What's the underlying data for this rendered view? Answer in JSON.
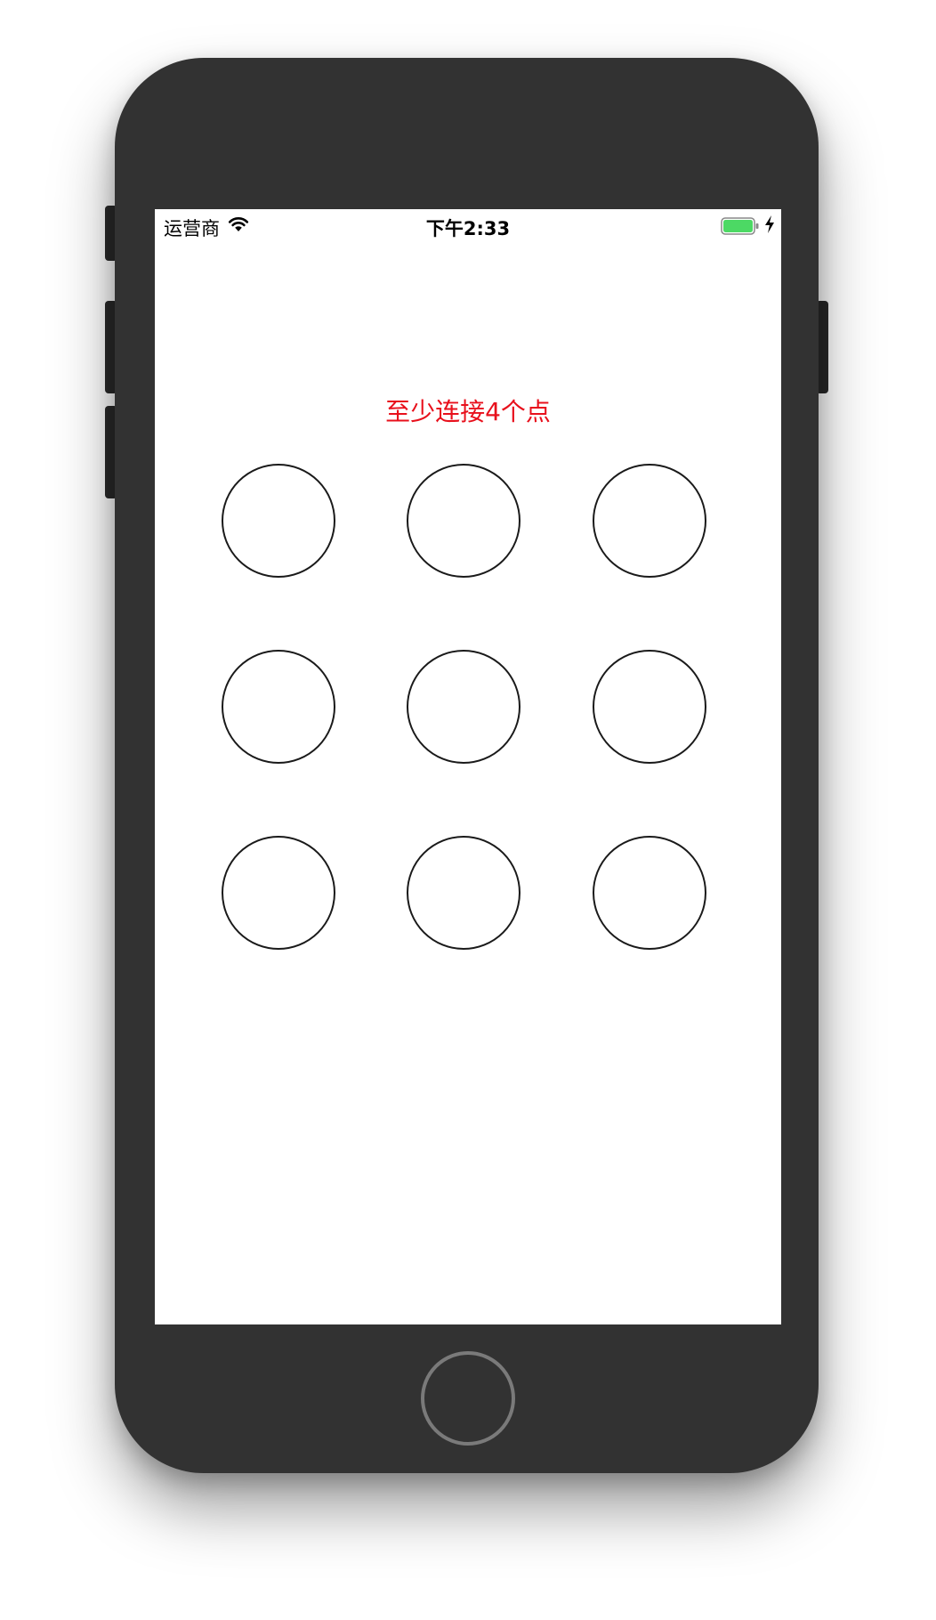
{
  "status_bar": {
    "carrier": "运营商",
    "time": "下午2:33",
    "wifi_icon": "wifi-icon",
    "battery_icon": "battery-full-icon",
    "battery_color": "#4cd964",
    "charging_icon": "charging-bolt-icon"
  },
  "lock_screen": {
    "hint": "至少连接4个点",
    "hint_color": "#e8101c",
    "dots": [
      {
        "row": 1,
        "col": 1
      },
      {
        "row": 1,
        "col": 2
      },
      {
        "row": 1,
        "col": 3
      },
      {
        "row": 2,
        "col": 1
      },
      {
        "row": 2,
        "col": 2
      },
      {
        "row": 2,
        "col": 3
      },
      {
        "row": 3,
        "col": 1
      },
      {
        "row": 3,
        "col": 2
      },
      {
        "row": 3,
        "col": 3
      }
    ]
  },
  "device": {
    "body_color": "#323232",
    "home_button_icon": "home-button"
  }
}
